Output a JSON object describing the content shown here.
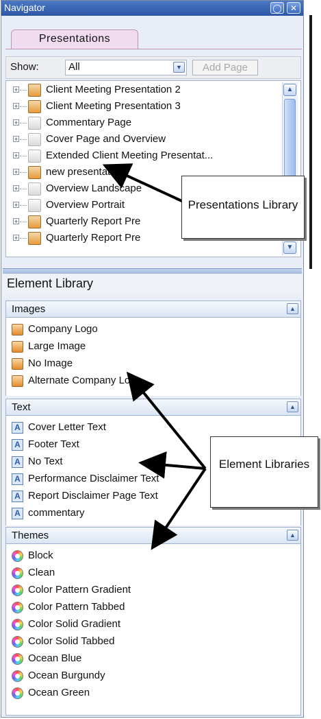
{
  "window": {
    "title": "Navigator",
    "pin_icon": "pin-icon",
    "close_icon": "close-icon"
  },
  "tab": {
    "label": "Presentations"
  },
  "show": {
    "label": "Show:",
    "value": "All",
    "add_page_label": "Add Page"
  },
  "presentations": [
    {
      "label": "Client Meeting Presentation 2",
      "icon": "presentation-color"
    },
    {
      "label": "Client Meeting Presentation 3",
      "icon": "presentation-color"
    },
    {
      "label": "Commentary Page",
      "icon": "page-grey"
    },
    {
      "label": "Cover Page and Overview",
      "icon": "page-grey"
    },
    {
      "label": "Extended Client Meeting Presentat...",
      "icon": "page-grey"
    },
    {
      "label": "new presentation",
      "icon": "presentation-color"
    },
    {
      "label": "Overview Landscape",
      "icon": "page-grey"
    },
    {
      "label": "Overview Portrait",
      "icon": "page-grey"
    },
    {
      "label": "Quarterly Report Pre",
      "icon": "presentation-color"
    },
    {
      "label": "Quarterly Report Pre",
      "icon": "presentation-color"
    }
  ],
  "element_library": {
    "title": "Element Library",
    "images": {
      "header": "Images",
      "items": [
        "Company Logo",
        "Large Image",
        "No Image",
        "Alternate Company Logo"
      ]
    },
    "text": {
      "header": "Text",
      "items": [
        "Cover Letter Text",
        "Footer Text",
        "No Text",
        "Performance Disclaimer Text",
        "Report Disclaimer Page Text",
        "commentary"
      ]
    },
    "themes": {
      "header": "Themes",
      "items": [
        "Block",
        "Clean",
        "Color Pattern Gradient",
        "Color Pattern Tabbed",
        "Color Solid Gradient",
        "Color Solid Tabbed",
        "Ocean Blue",
        "Ocean Burgundy",
        "Ocean Green"
      ]
    }
  },
  "callouts": {
    "presentations_library": "Presentations Library",
    "element_libraries": "Element Libraries"
  },
  "colors": {
    "titlebar": "#2c57a6",
    "tab": "#f1dcef",
    "panel_border": "#9db1d3"
  }
}
